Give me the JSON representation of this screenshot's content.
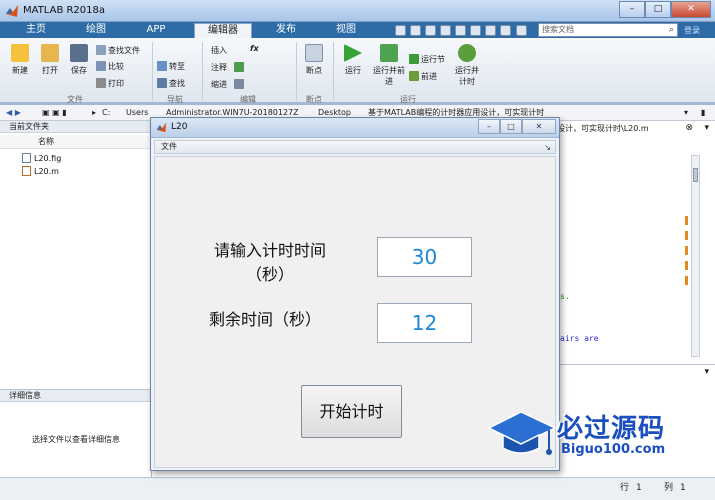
{
  "app": {
    "title": "MATLAB R2018a",
    "accent": "#2d6ca6"
  },
  "window_buttons": {
    "minimize": "–",
    "maximize": "□",
    "close": "✕"
  },
  "tabs": [
    {
      "label": "主页",
      "active": false
    },
    {
      "label": "绘图",
      "active": false
    },
    {
      "label": "APP",
      "active": false
    },
    {
      "label": "编辑器",
      "active": true
    },
    {
      "label": "发布",
      "active": false
    },
    {
      "label": "视图",
      "active": false
    }
  ],
  "search": {
    "placeholder": "搜索文档",
    "extra": "登录"
  },
  "ribbon": {
    "file_group": {
      "label": "文件",
      "new": "新建",
      "open": "打开",
      "save": "保存",
      "find_files": "查找文件",
      "compare": "比较",
      "print": "打印"
    },
    "nav_group": {
      "label": "导航",
      "goto": "转至",
      "find": "查找"
    },
    "edit_group": {
      "label": "编辑",
      "insert": "插入",
      "fx": "fx",
      "comment": "注释",
      "indent": "缩进"
    },
    "breakpoint_group": {
      "label": "断点",
      "breakpoints": "断点"
    },
    "run_group": {
      "label": "运行",
      "run": "运行",
      "run_advance": "运行并前进",
      "run_section": "运行节",
      "advance": "前进",
      "run_time": "运行并计时"
    }
  },
  "address": {
    "parts": [
      "C:",
      "Users",
      "Administrator.WIN7U-20180127Z",
      "Desktop",
      "基于MATLAB编程的计时器应用设计，可实现计时"
    ]
  },
  "current_folder": {
    "header": "当前文件夹",
    "column": "名称",
    "files": [
      "L20.fig",
      "L20.m"
    ]
  },
  "details": {
    "header": "详细信息",
    "message": "选择文件以查看详细信息"
  },
  "editor": {
    "tab_title": "设计，可实现计时\\L20.m",
    "code_fragments": [
      "s.",
      "airs are"
    ]
  },
  "status": {
    "line_label": "行",
    "line": "1",
    "col_label": "列",
    "col": "1"
  },
  "dialog": {
    "title": "L20",
    "menu": "文件",
    "input_label_line1": "请输入计时时间",
    "input_label_line2": "（秒）",
    "input_value": "30",
    "remaining_label": "剩余时间（秒）",
    "remaining_value": "12",
    "start_button": "开始计时",
    "number_color": "#1b87d6"
  },
  "watermark": {
    "cn": "必过源码",
    "en": "Biguo100.com"
  }
}
